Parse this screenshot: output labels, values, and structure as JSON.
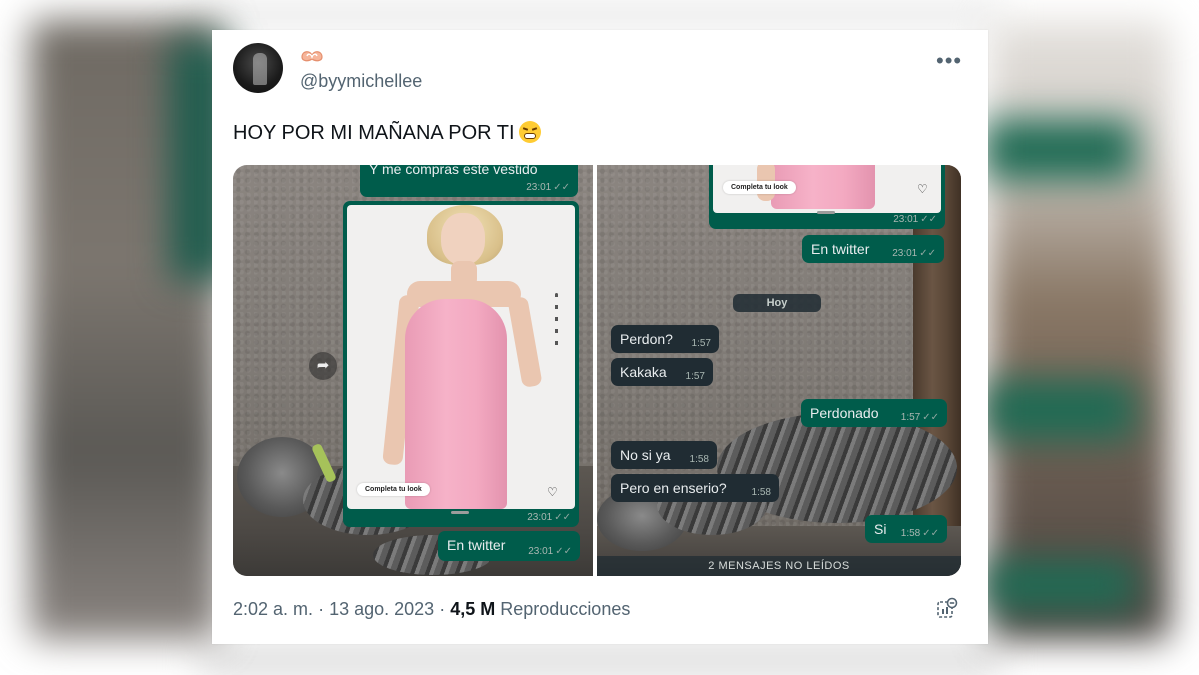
{
  "tweet": {
    "handle": "@byymichellee",
    "text": "HOY POR MI MAÑANA POR TI",
    "time": "2:02 a. m.",
    "separator": "·",
    "date": "13 ago. 2023",
    "views_count": "4,5 M",
    "views_label": "Reproducciones",
    "more_icon": "more-horizontal-icon",
    "emoji_icon": "weary-face-emoji",
    "badge_icon": "heart-hands-emoji"
  },
  "left_chat": {
    "top_bubble_text": "Y me compras este vestido",
    "top_bubble_time": "23:01",
    "product_time": "23:01",
    "product_pill": "Completa tu look",
    "bottom_bubble_text": "En twitter",
    "bottom_bubble_time": "23:01"
  },
  "right_chat": {
    "product_pill": "Completa tu look",
    "product_time": "23:01",
    "date_chip": "Hoy",
    "messages": [
      {
        "text": "En twitter",
        "time": "23:01",
        "dir": "out"
      },
      {
        "text": "Perdon?",
        "time": "1:57",
        "dir": "in"
      },
      {
        "text": "Kakaka",
        "time": "1:57",
        "dir": "in"
      },
      {
        "text": "Perdonado",
        "time": "1:57",
        "dir": "out"
      },
      {
        "text": "No si ya",
        "time": "1:58",
        "dir": "in"
      },
      {
        "text": "Pero en enserio?",
        "time": "1:58",
        "dir": "in"
      },
      {
        "text": "Si",
        "time": "1:58",
        "dir": "out"
      }
    ],
    "unread": "2 MENSAJES NO LEÍDOS"
  },
  "colors": {
    "outgoing_bubble": "#005c4b",
    "incoming_bubble": "#202c33",
    "muted_text": "#536471",
    "dress_pink": "#f3a9c1"
  }
}
